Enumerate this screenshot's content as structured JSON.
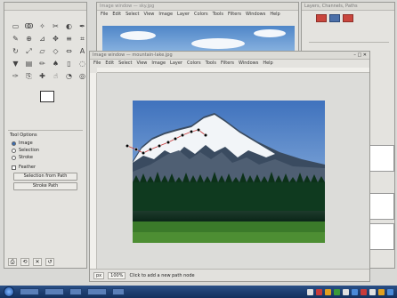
{
  "colors": {
    "window_bg": "#e4e3df",
    "sky_top": "#3f72bd",
    "sky_bottom": "#a9c8ea",
    "forest": "#0f3a1f",
    "meadow": "#3b7a2a",
    "taskbar": "#1d3f73",
    "dock_accent": "#c9463d"
  },
  "toolbox": {
    "icons": [
      "select-icon",
      "lasso-icon",
      "fuzzy-select-icon",
      "scissors-icon",
      "foreground-select-icon",
      "paths-icon",
      "color-picker-icon",
      "zoom-icon",
      "measure-icon",
      "move-icon",
      "align-icon",
      "crop-icon",
      "rotate-icon",
      "scale-icon",
      "shear-icon",
      "perspective-icon",
      "flip-icon",
      "text-icon",
      "bucket-icon",
      "gradient-icon",
      "pencil-icon",
      "brush-icon",
      "eraser-icon",
      "airbrush-icon",
      "ink-icon",
      "clone-icon",
      "heal-icon",
      "smudge-icon",
      "dodge-icon",
      "blur-icon"
    ],
    "glyphs": [
      "▭",
      "ↂ",
      "✧",
      "✂",
      "◐",
      "✒",
      "✎",
      "⊕",
      "⊿",
      "✥",
      "≡",
      "⌗",
      "↻",
      "⤢",
      "▱",
      "◇",
      "⇔",
      "A",
      "▼",
      "▤",
      "✏",
      "♠",
      "▯",
      "◌",
      "✑",
      "⎘",
      "✚",
      "☝",
      "◔",
      "◎"
    ]
  },
  "tool_options": {
    "section": "Tool Options",
    "radios": [
      "Image",
      "Selection",
      "Stroke"
    ],
    "checkbox": "Feather",
    "buttons": [
      "Selection from Path",
      "Stroke Path"
    ]
  },
  "main_window": {
    "title": "Image window — mountain-lake.jpg",
    "menus": [
      "File",
      "Edit",
      "Select",
      "View",
      "Image",
      "Layer",
      "Colors",
      "Tools",
      "Filters",
      "Windows",
      "Help"
    ],
    "status_zoom": "100%",
    "status_unit": "px",
    "status_text": "Click to add a new path node"
  },
  "back_window": {
    "title": "Image window — sky.jpg",
    "menus": [
      "File",
      "Edit",
      "Select",
      "View",
      "Image",
      "Layer",
      "Colors",
      "Tools",
      "Filters",
      "Windows",
      "Help"
    ]
  },
  "dock": {
    "title": "Layers, Channels, Paths"
  }
}
